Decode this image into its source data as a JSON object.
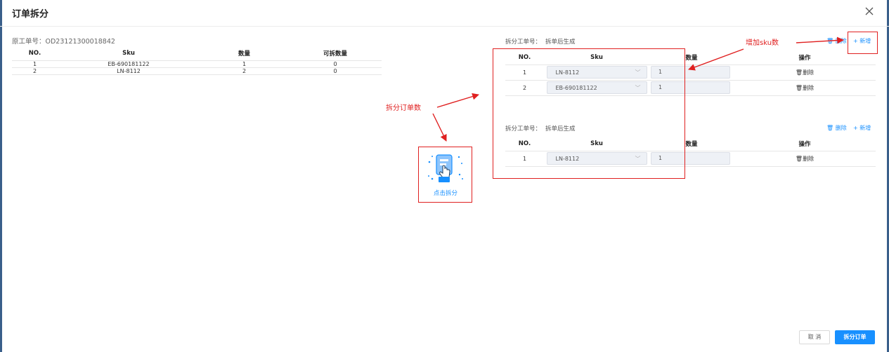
{
  "dialog": {
    "title": "订单拆分",
    "close_icon": "close-icon"
  },
  "original": {
    "label": "原工单号：",
    "order_no": "OD23121300018842",
    "columns": [
      "NO.",
      "Sku",
      "数量",
      "可拆数量"
    ],
    "rows": [
      {
        "no": "1",
        "sku": "EB-690181122",
        "qty": "1",
        "splittable": "0"
      },
      {
        "no": "2",
        "sku": "LN-8112",
        "qty": "2",
        "splittable": "0"
      }
    ]
  },
  "splits": [
    {
      "label": "拆分工单号：",
      "value": "拆单后生成",
      "delete_label": "删除",
      "add_label": "新增",
      "columns": [
        "NO.",
        "Sku",
        "数量",
        "操作"
      ],
      "rows": [
        {
          "no": "1",
          "sku": "LN-8112",
          "qty": "1",
          "action": "删除"
        },
        {
          "no": "2",
          "sku": "EB-690181122",
          "qty": "1",
          "action": "删除"
        }
      ]
    },
    {
      "label": "拆分工单号：",
      "value": "拆单后生成",
      "delete_label": "删除",
      "add_label": "新增",
      "columns": [
        "NO.",
        "Sku",
        "数量",
        "操作"
      ],
      "rows": [
        {
          "no": "1",
          "sku": "LN-8112",
          "qty": "1",
          "action": "删除"
        }
      ]
    }
  ],
  "split_action": {
    "label": "点击拆分",
    "icon": "tap-split-icon"
  },
  "annotations": {
    "add_sku": "增加sku数",
    "split_count": "拆分订单数"
  },
  "footer": {
    "cancel_label": "取 消",
    "split_label": "拆分订单"
  },
  "colors": {
    "primary": "#1890ff",
    "annotation": "#e02020",
    "field_bg": "#eef1f6"
  }
}
